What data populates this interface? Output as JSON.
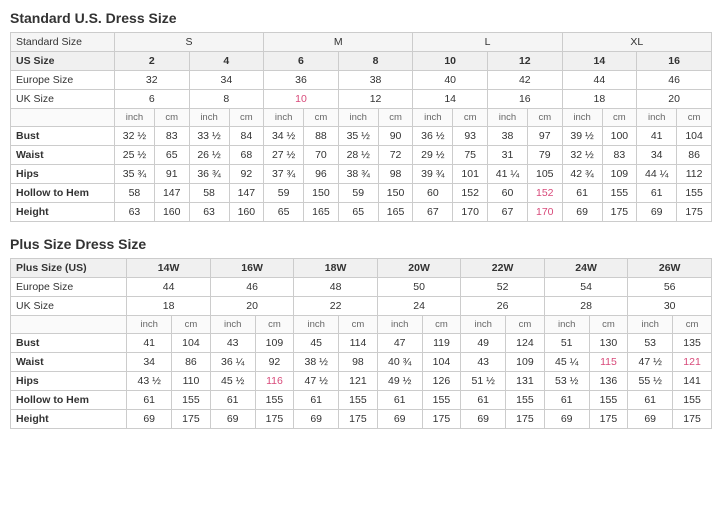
{
  "standard": {
    "title": "Standard U.S. Dress Size",
    "sizeGroups": [
      "Standard Size",
      "S",
      "",
      "",
      "M",
      "",
      "",
      "L",
      "",
      "",
      "XL",
      ""
    ],
    "headerRow": [
      "US Size",
      "2",
      "4",
      "6",
      "8",
      "10",
      "12",
      "14",
      "16"
    ],
    "europeRow": [
      "Europe Size",
      "32",
      "34",
      "36",
      "38",
      "40",
      "42",
      "44",
      "46"
    ],
    "ukRow": [
      "UK Size",
      "6",
      "8",
      "10",
      "12",
      "14",
      "16",
      "18",
      "20"
    ],
    "unitLabels": [
      "",
      "inch",
      "cm",
      "inch",
      "cm",
      "inch",
      "cm",
      "inch",
      "cm",
      "inch",
      "cm",
      "inch",
      "cm",
      "inch",
      "cm",
      "inch",
      "cm"
    ],
    "rows": [
      [
        "Bust",
        "32 ½",
        "83",
        "33 ½",
        "84",
        "34 ½",
        "88",
        "35 ½",
        "90",
        "36 ½",
        "93",
        "38",
        "97",
        "39 ½",
        "100",
        "41",
        "104"
      ],
      [
        "Waist",
        "25 ½",
        "65",
        "26 ½",
        "68",
        "27 ½",
        "70",
        "28 ½",
        "72",
        "29 ½",
        "75",
        "31",
        "79",
        "32 ½",
        "83",
        "34",
        "86"
      ],
      [
        "Hips",
        "35 ¾",
        "91",
        "36 ¾",
        "92",
        "37 ¾",
        "96",
        "38 ¾",
        "98",
        "39 ¾",
        "101",
        "41 ¼",
        "105",
        "42 ¾",
        "109",
        "44 ¼",
        "112"
      ],
      [
        "Hollow to Hem",
        "58",
        "147",
        "58",
        "147",
        "59",
        "150",
        "59",
        "150",
        "60",
        "152",
        "60",
        "152",
        "61",
        "155",
        "61",
        "155"
      ],
      [
        "Height",
        "63",
        "160",
        "63",
        "160",
        "65",
        "165",
        "65",
        "165",
        "67",
        "170",
        "67",
        "170",
        "69",
        "175",
        "69",
        "175"
      ]
    ],
    "pinkCells": {
      "ukRow": [
        3
      ],
      "bust": [],
      "waist": [],
      "hips": [
        5,
        13
      ],
      "hollowToHem": [
        11,
        12
      ],
      "height": [
        11,
        12
      ]
    }
  },
  "plus": {
    "title": "Plus Size Dress Size",
    "headerRow": [
      "Plus Size (US)",
      "14W",
      "",
      "16W",
      "",
      "18W",
      "",
      "20W",
      "",
      "22W",
      "",
      "24W",
      "",
      "26W",
      ""
    ],
    "sizeHeaderRow": [
      "Plus Size (US)",
      "14W",
      "16W",
      "18W",
      "20W",
      "22W",
      "24W",
      "26W"
    ],
    "europeRow": [
      "Europe Size",
      "44",
      "46",
      "48",
      "50",
      "52",
      "54",
      "56"
    ],
    "ukRow": [
      "UK Size",
      "18",
      "20",
      "22",
      "24",
      "26",
      "28",
      "30"
    ],
    "unitLabels": [
      "",
      "inch",
      "cm",
      "inch",
      "cm",
      "inch",
      "cm",
      "inch",
      "cm",
      "inch",
      "cm",
      "inch",
      "cm",
      "inch",
      "cm"
    ],
    "rows": [
      [
        "Bust",
        "41",
        "104",
        "43",
        "109",
        "45",
        "114",
        "47",
        "119",
        "49",
        "124",
        "51",
        "130",
        "53",
        "135"
      ],
      [
        "Waist",
        "34",
        "86",
        "36 ¼",
        "92",
        "38 ½",
        "98",
        "40 ¾",
        "104",
        "43",
        "109",
        "45 ¼",
        "115",
        "47 ½",
        "121"
      ],
      [
        "Hips",
        "43 ½",
        "110",
        "45 ½",
        "116",
        "47 ½",
        "121",
        "49 ½",
        "126",
        "51 ½",
        "131",
        "53 ½",
        "136",
        "55 ½",
        "141"
      ],
      [
        "Hollow to Hem",
        "61",
        "155",
        "61",
        "155",
        "61",
        "155",
        "61",
        "155",
        "61",
        "155",
        "61",
        "155",
        "61",
        "155"
      ],
      [
        "Height",
        "69",
        "175",
        "69",
        "175",
        "69",
        "175",
        "69",
        "175",
        "69",
        "175",
        "69",
        "175",
        "69",
        "175"
      ]
    ],
    "pinkCells": {
      "ukRow": [],
      "waist": [
        11,
        13
      ],
      "hips": [
        3,
        13
      ],
      "hollowToHem": [],
      "height": []
    }
  }
}
